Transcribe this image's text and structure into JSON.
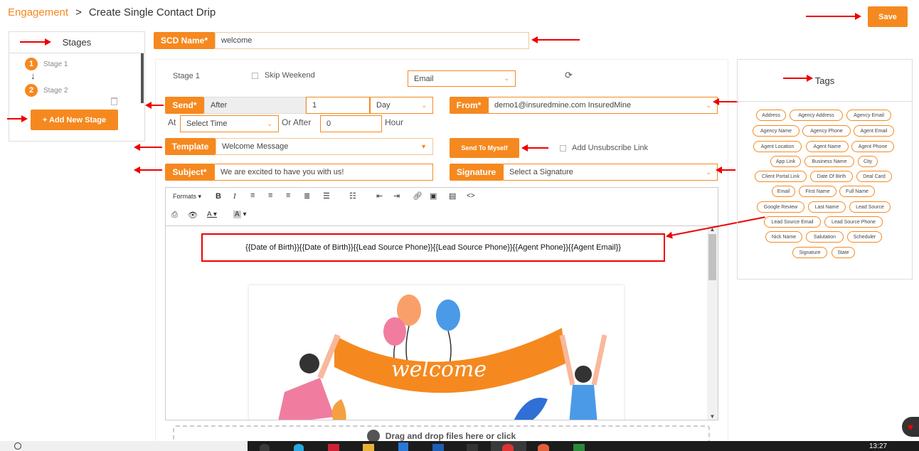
{
  "breadcrumb": {
    "root": "Engagement",
    "separator": ">",
    "current": "Create Single Contact Drip"
  },
  "save_label": "Save",
  "stages": {
    "title": "Stages",
    "items": [
      {
        "num": "1",
        "label": "Stage 1"
      },
      {
        "num": "2",
        "label": "Stage 2"
      }
    ],
    "add_label": "+ Add New Stage"
  },
  "scd": {
    "label": "SCD Name*",
    "value": "welcome"
  },
  "stage_header": {
    "title": "Stage 1",
    "skip_weekend": "Skip Weekend",
    "channel": "Email"
  },
  "send": {
    "label": "Send*",
    "after": "After",
    "number": "1",
    "unit": "Day",
    "at": "At",
    "time_placeholder": "Select Time",
    "or_after": "Or After",
    "hours": "0",
    "hour_label": "Hour"
  },
  "from": {
    "label": "From*",
    "value": "demo1@insuredmine.com InsuredMine"
  },
  "template": {
    "label": "Template",
    "value": "Welcome Message"
  },
  "send_to_myself": "Send To Myself",
  "unsubscribe": "Add Unsubscribe Link",
  "subject": {
    "label": "Subject*",
    "value": "We are excited to have you with us!"
  },
  "signature": {
    "label": "Signature",
    "placeholder": "Select a Signature"
  },
  "editor": {
    "formats": "Formats",
    "body_text": "{{Date of Birth}}{{Date of Birth}}{{Lead Source Phone}}{{Lead Source Phone}}{{Agent Phone}}{{Agent Email}}",
    "image_text": "welcome",
    "dropzone": "Drag and drop files here or click"
  },
  "tags": {
    "title": "Tags",
    "items": [
      "Address",
      "Agency Address",
      "Agency Email",
      "Agency Name",
      "Agency Phone",
      "Agent Email",
      "Agent Location",
      "Agent Name",
      "Agent Phone",
      "App Link",
      "Business Name",
      "City",
      "Client Portal Link",
      "Date Of Birth",
      "Deal Card",
      "Email",
      "First Name",
      "Full Name",
      "Google Review",
      "Last Name",
      "Lead Source",
      "Lead Source Email",
      "Lead Source Phone",
      "Nick Name",
      "Salutation",
      "Scheduler",
      "Signature",
      "State"
    ]
  },
  "taskbar": {
    "time": "13:27"
  },
  "colors": {
    "accent": "#f5891f",
    "annotation": "#e00000"
  }
}
